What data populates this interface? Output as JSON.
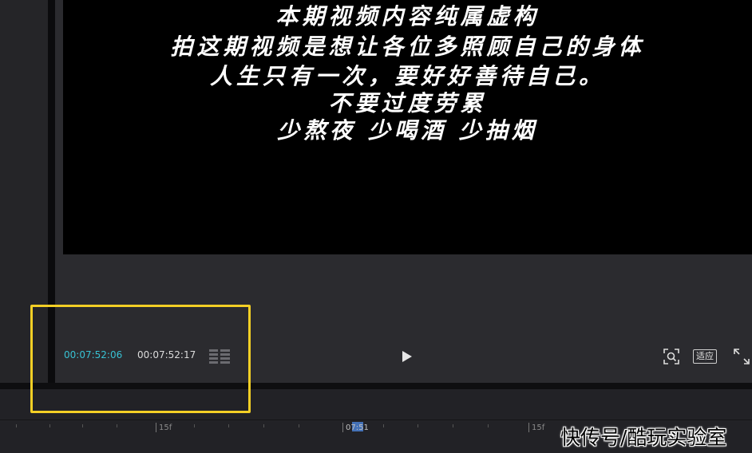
{
  "preview": {
    "captions": [
      "本期视频内容纯属虚构",
      "拍这期视频是想让各位多照顾自己的身体",
      "人生只有一次，要好好善待自己。",
      "不要过度劳累",
      "少熬夜 少喝酒 少抽烟"
    ]
  },
  "player": {
    "current_time": "00:07:52:06",
    "total_time": "00:07:52:17",
    "fit_label": "适应"
  },
  "timeline": {
    "tick_labels": [
      "15f",
      "07:51",
      "15f"
    ]
  },
  "watermark": "快传号/酷玩实验室",
  "colors": {
    "accent_timecode": "#38c2d3",
    "highlight": "#f3cf25",
    "preview_bg": "#000000",
    "panel_bg": "#2b2b2f"
  },
  "icons": [
    "list-icon",
    "play-icon",
    "zoom-icon",
    "fullscreen-icon"
  ]
}
